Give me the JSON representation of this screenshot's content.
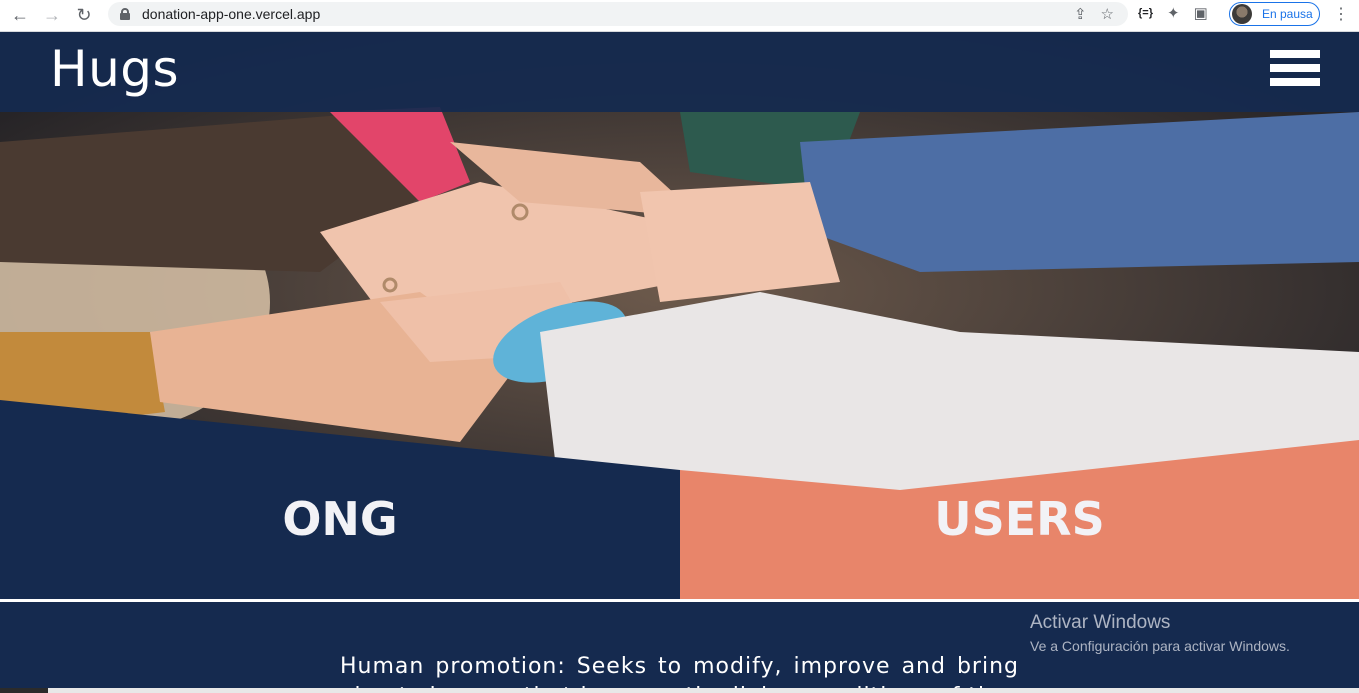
{
  "browser": {
    "url": "donation-app-one.vercel.app",
    "profile_label": "En pausa",
    "icons": [
      "back-icon",
      "forward-icon",
      "reload-icon",
      "lock-icon",
      "share-icon",
      "star-icon",
      "extension-json-icon",
      "puzzle-icon",
      "sidepanel-icon",
      "menu-kebab-icon"
    ]
  },
  "header": {
    "logo": "Hugs",
    "menu_icon": "hamburger-icon"
  },
  "hero": {
    "image": "hands-stacked-together-photo"
  },
  "split": {
    "left_label": "ONG",
    "right_label": "USERS",
    "right_color": "#e8856a",
    "left_color": "#152a4f"
  },
  "content": {
    "promo_text": "Human promotion: Seeks to modify, improve and bring about changes that improve the living conditions of the"
  },
  "os_overlay": {
    "title": "Activar Windows",
    "subtitle": "Ve a Configuración para activar Windows."
  }
}
